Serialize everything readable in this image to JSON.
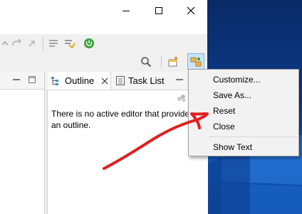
{
  "window": {
    "minimize_icon": "minimize-icon",
    "maximize_icon": "maximize-icon",
    "close_icon": "close-icon"
  },
  "toolbar": {
    "icons": [
      "undo-icon",
      "redo-icon",
      "nav-icon",
      "list-icon",
      "debug-icon",
      "power-icon",
      "search-icon",
      "open-perspective-icon",
      "perspective-icon"
    ],
    "accent": "#3aa23a"
  },
  "views": {
    "outline_tab": "Outline",
    "task_list_tab": "Task List",
    "outline_message_line1": "There is no active editor that provide",
    "outline_message_line2": "an outline."
  },
  "menu": {
    "items": [
      {
        "label": "Customize..."
      },
      {
        "label": "Save As..."
      },
      {
        "label": "Reset"
      },
      {
        "label": "Close"
      },
      {
        "label": "Show Text"
      }
    ]
  },
  "annotation": {
    "color": "#e02020",
    "shape": "arrow-icon"
  }
}
